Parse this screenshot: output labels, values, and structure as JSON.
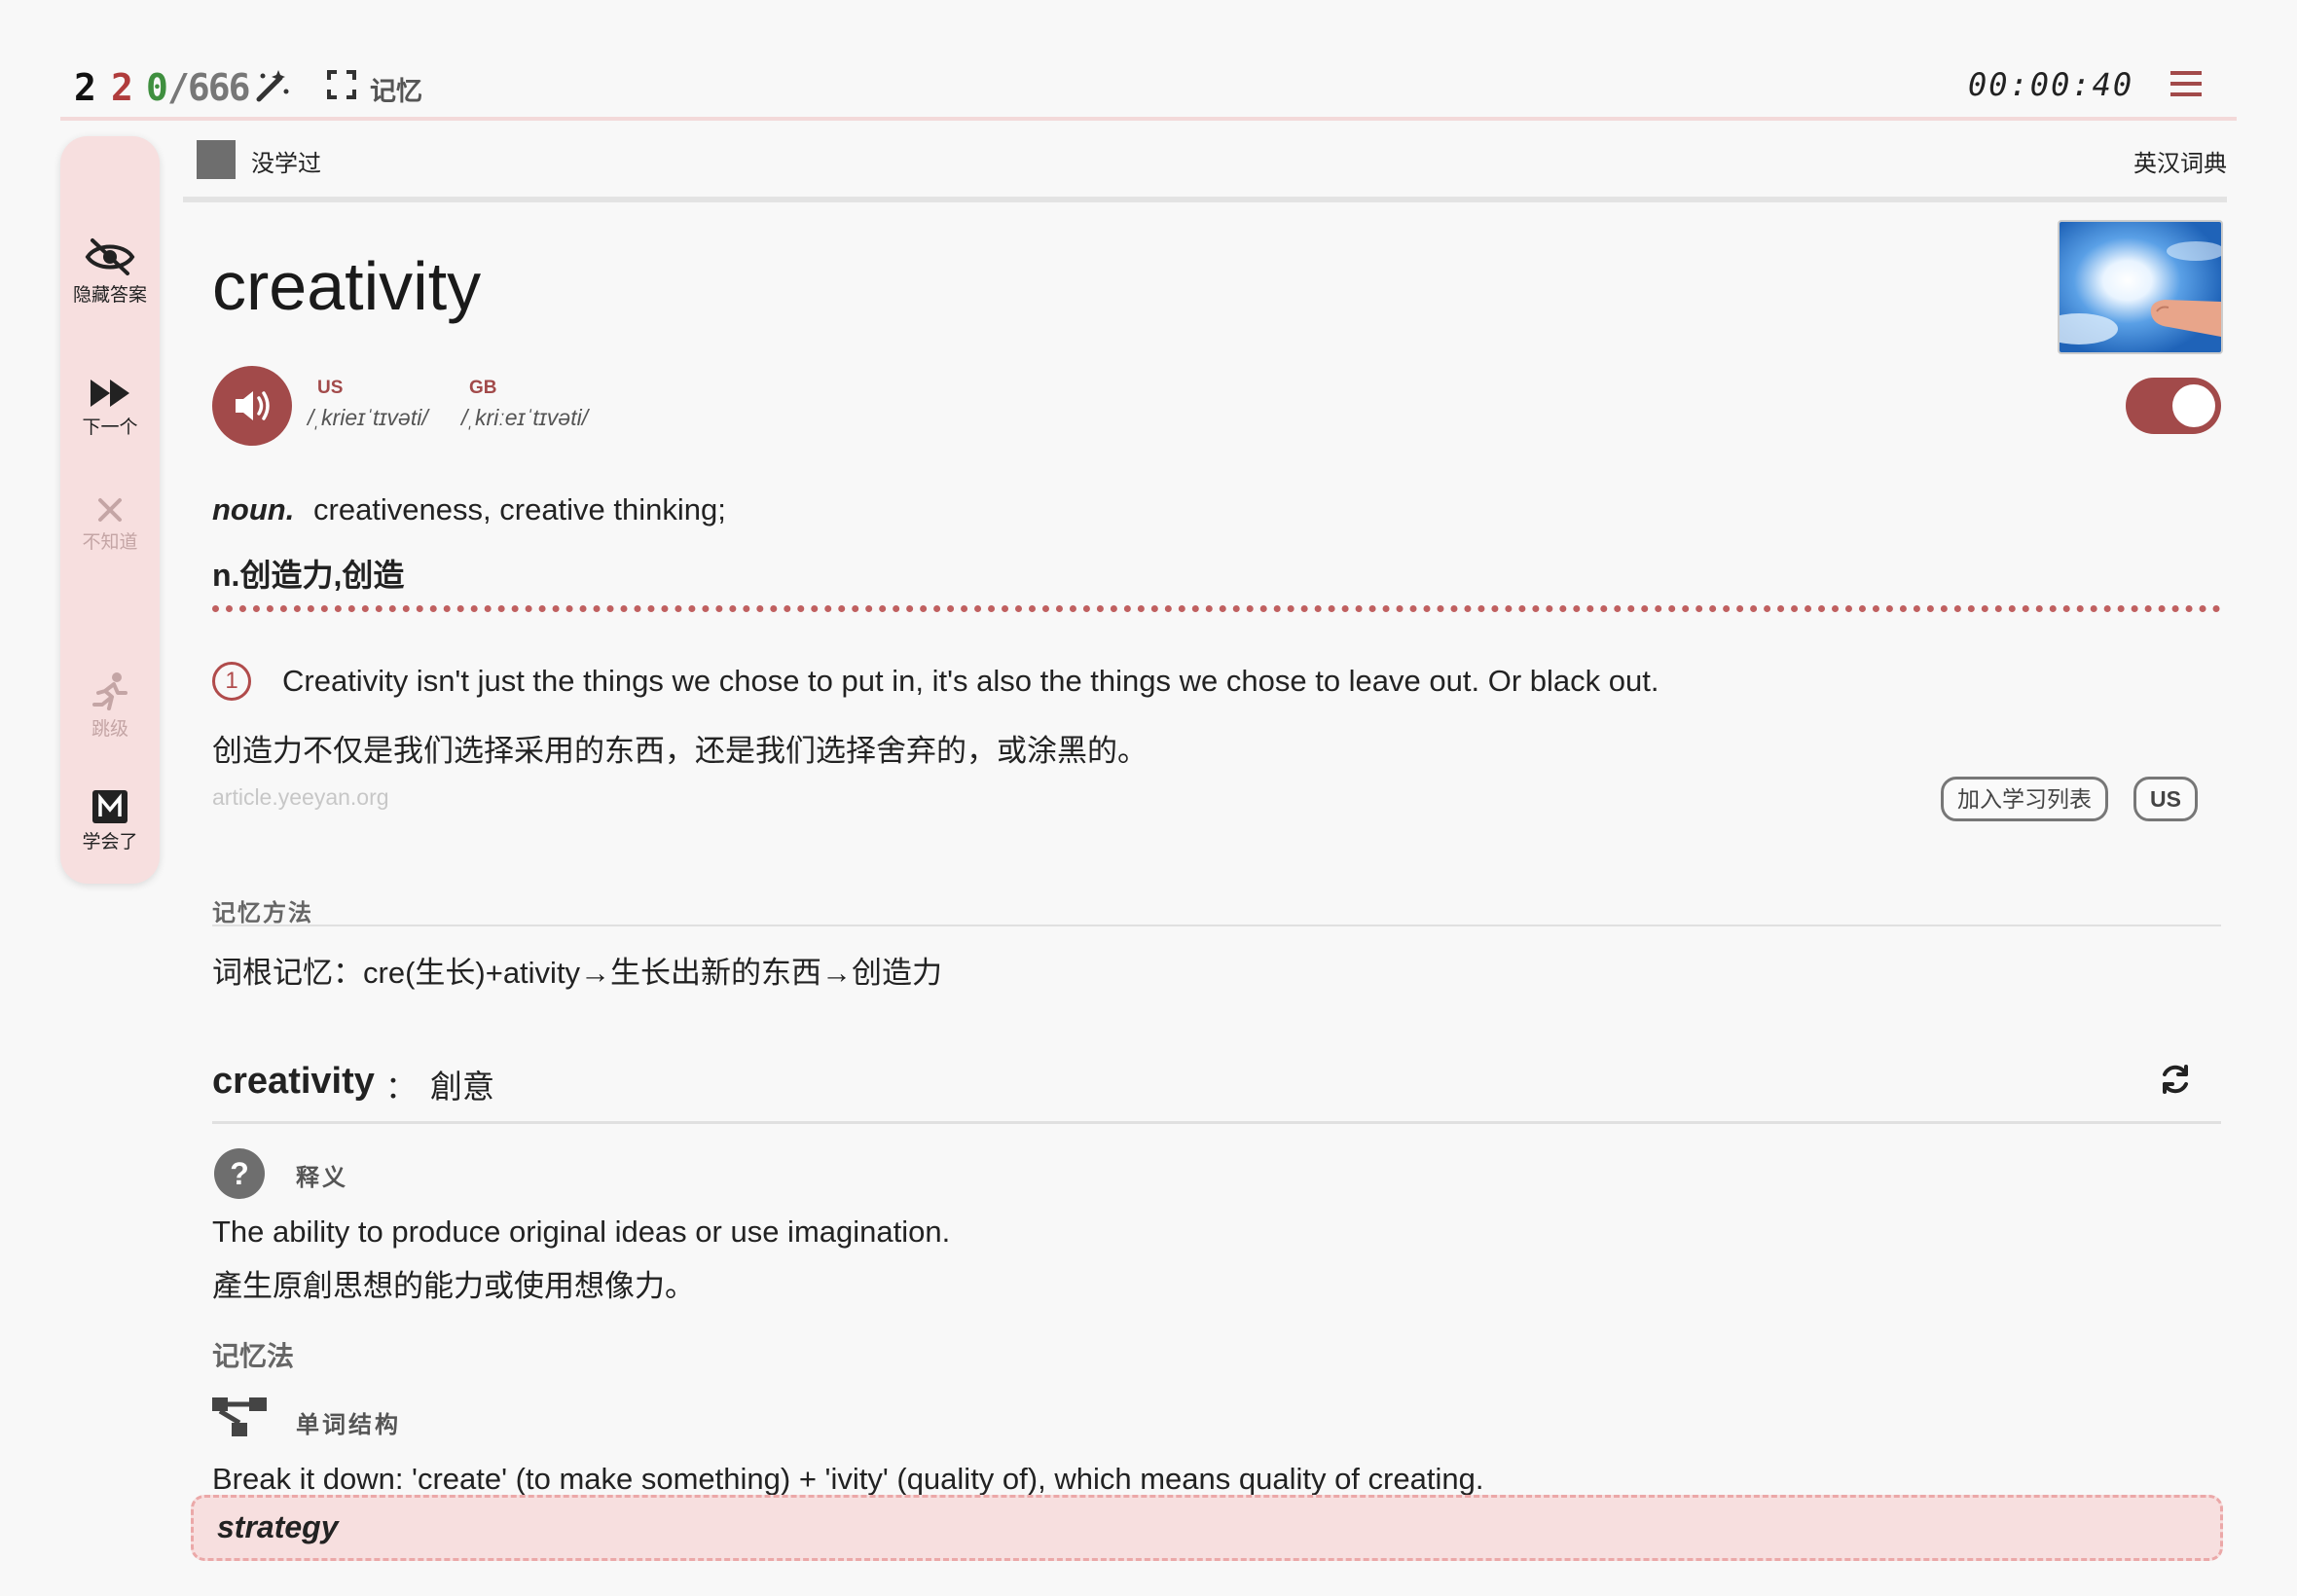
{
  "topbar": {
    "count_a": "2",
    "count_b": "2",
    "count_c": "0",
    "total": "/666",
    "memory_label": "记忆",
    "timer": "00:00:40",
    "icons": [
      "magic-wand-icon",
      "fullscreen-icon",
      "hamburger-menu-icon"
    ]
  },
  "sidebar": {
    "hide_answer": "隐藏答案",
    "next": "下一个",
    "dont_know": "不知道",
    "skip": "跳级",
    "learned": "学会了"
  },
  "status": {
    "label": "没学过",
    "dictionary": "英汉词典"
  },
  "word": {
    "text": "creativity",
    "us_label": "US",
    "us_phonetic": "/ˌkrieɪˈtɪvəti/",
    "gb_label": "GB",
    "gb_phonetic": "/ˌkriːeɪˈtɪvəti/"
  },
  "definition": {
    "pos": "noun.",
    "en": "creativeness, creative thinking;",
    "zh": "n.创造力,创造"
  },
  "example": {
    "number": "1",
    "en": "Creativity isn't just the things we chose to put in, it's also the things we chose to leave out. Or black out.",
    "zh": "创造力不仅是我们选择采用的东西，还是我们选择舍弃的，或涂黑的。",
    "source": "article.yeeyan.org",
    "add_list": "加入学习列表",
    "accent_button": "US"
  },
  "memory": {
    "heading": "记忆方法",
    "text": "词根记忆：cre(生长)+ativity→生长出新的东西→创造力"
  },
  "ai_section": {
    "word": "creativity",
    "colon": "：",
    "translation": "創意",
    "gloss_heading": "释义",
    "gloss_en": "The ability to produce original ideas or use imagination.",
    "gloss_zh": "產生原創思想的能力或使用想像力。",
    "mnemonic_heading": "记忆法",
    "structure_heading": "单词结构",
    "breakdown": "Break it down: 'create' (to make something) + 'ivity' (quality of), which means quality of creating."
  },
  "bottom_bar": {
    "next_word": "strategy"
  },
  "colors": {
    "accent": "#a24a4a",
    "sidebar_bg": "#f7dfdf",
    "count_red": "#b03c3c",
    "count_green": "#3f8f3f"
  }
}
